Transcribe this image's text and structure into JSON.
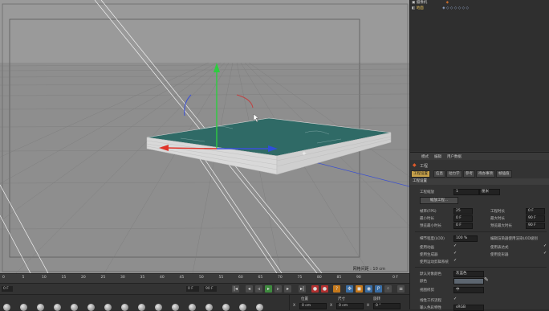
{
  "viewport": {
    "grid_spacing_label": "网格间距 : 10 cm",
    "colors": {
      "background": "#9a9a9a",
      "floor": "#8e8e8e",
      "grid": "#7d7d7d",
      "object_top": "#2f6a66",
      "axis_y": "#2ecc40",
      "axis_x": "#e0342a",
      "axis_z": "#2f4fd8"
    }
  },
  "timeline": {
    "ticks": [
      "0",
      "5",
      "10",
      "15",
      "20",
      "25",
      "30",
      "35",
      "40",
      "45",
      "50",
      "55",
      "60",
      "65",
      "70",
      "75",
      "80",
      "85",
      "90"
    ],
    "frame_readout": "0 F",
    "current_frame": "0 F",
    "end_frame": "90 F",
    "transport_icons": [
      "first-frame-icon",
      "prev-key-icon",
      "prev-frame-icon",
      "play-icon",
      "next-frame-icon",
      "next-key-icon",
      "last-frame-icon",
      "record-icon",
      "autokey-icon",
      "keyframe-icon",
      "move-key-icon",
      "rotate-key-icon",
      "scale-key-icon",
      "param-key-icon",
      "pla-key-icon",
      "menu-icon"
    ]
  },
  "coords": {
    "headers": [
      "位置",
      "尺寸",
      "旋转"
    ],
    "row1": [
      "X",
      "0 cm",
      "X",
      "0 cm",
      "H",
      "0 °"
    ]
  },
  "object_manager": {
    "rows": [
      {
        "label": "摄像机",
        "icon": "camera-icon"
      },
      {
        "label": "地面",
        "icon": "floor-icon"
      }
    ]
  },
  "attributes": {
    "tabs": [
      "模式",
      "编辑",
      "用户数据"
    ],
    "title": "工程",
    "sub_tabs": [
      "工程设置",
      "信息",
      "动力学",
      "参考",
      "待办事项",
      "帧插值"
    ],
    "active_sub_tab": "工程设置",
    "section": "工程设置",
    "scale_label": "工程缩放",
    "scale_value": "1",
    "scale_unit": "厘米",
    "scale_button": "缩放工程...",
    "left_fields": [
      {
        "label": "帧率(FPS)",
        "value": "25"
      },
      {
        "label": "最小时长",
        "value": "0 F"
      },
      {
        "label": "预览最小时长",
        "value": "0 F"
      }
    ],
    "right_fields": [
      {
        "label": "工程时长",
        "value": "0 F"
      },
      {
        "label": "最大时长",
        "value": "90 F"
      },
      {
        "label": "预览最大时长",
        "value": "90 F"
      }
    ],
    "lod_label": "细节程度(LOD)",
    "lod_value": "100 %",
    "lod_right": "编辑渲染器使用渲染LOD级别",
    "checks_left": [
      {
        "label": "使用动画",
        "checked": "✓"
      },
      {
        "label": "使用生成器",
        "checked": "✓"
      },
      {
        "label": "使用运动剪辑系统",
        "checked": "✓"
      }
    ],
    "checks_right": [
      {
        "label": "使用表达式",
        "checked": "✓"
      },
      {
        "label": "使用变形器",
        "checked": "✓"
      }
    ],
    "default_color_label": "默认对象颜色",
    "default_color_value": "灰蓝色",
    "color_label": "颜色",
    "view_clip_label": "视图修剪",
    "view_clip_value": "中",
    "linear_label": "线性工作流程",
    "input_color_label": "输入色彩特性",
    "input_color_value": "sRGB"
  }
}
